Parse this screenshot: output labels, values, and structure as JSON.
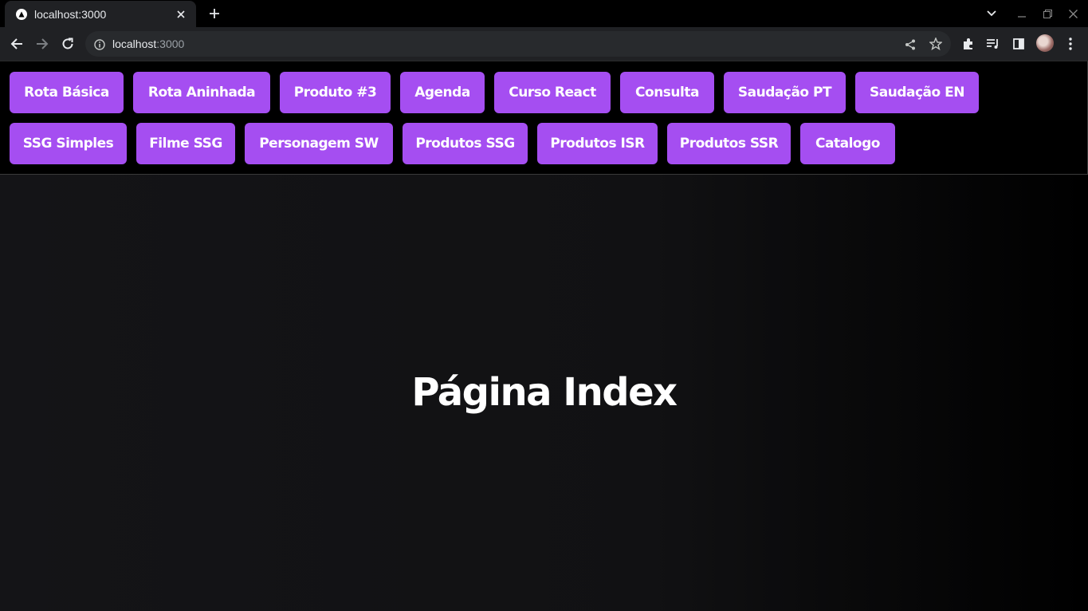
{
  "browser": {
    "tab_title": "localhost:3000",
    "url_host": "localhost",
    "url_port": ":3000"
  },
  "nav": {
    "row1": [
      "Rota Básica",
      "Rota Aninhada",
      "Produto #3",
      "Agenda",
      "Curso React",
      "Consulta",
      "Saudação PT",
      "Saudação EN"
    ],
    "row2": [
      "SSG Simples",
      "Filme SSG",
      "Personagem SW",
      "Produtos SSG",
      "Produtos ISR",
      "Produtos SSR",
      "Catalogo"
    ]
  },
  "main": {
    "title": "Página Index"
  },
  "colors": {
    "accent": "#a54ef1",
    "background": "#111113"
  },
  "icons": [
    "nextjs-favicon-icon",
    "close-icon",
    "plus-icon",
    "chevron-down-icon",
    "minimize-icon",
    "restore-icon",
    "back-arrow-icon",
    "forward-arrow-icon",
    "reload-icon",
    "info-icon",
    "share-icon",
    "star-icon",
    "puzzle-icon",
    "media-control-icon",
    "side-panel-icon",
    "kebab-menu-icon"
  ]
}
